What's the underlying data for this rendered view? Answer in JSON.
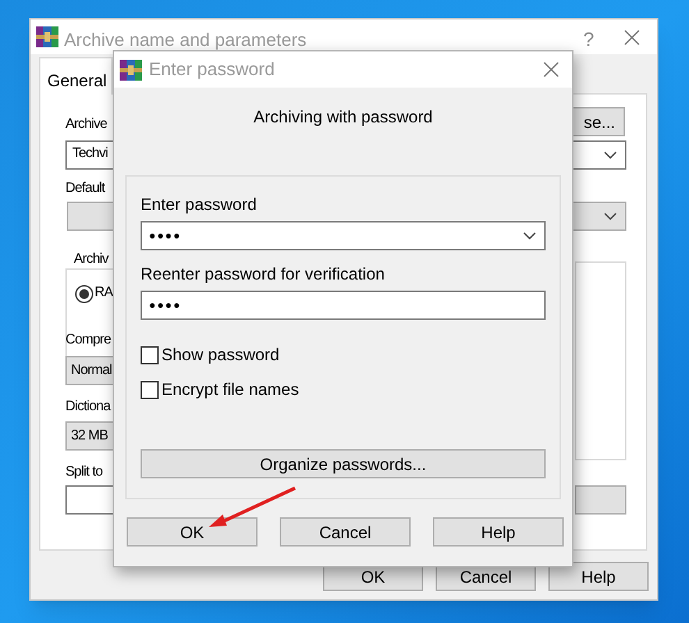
{
  "background_window": {
    "title": "Archive name and parameters",
    "help": "?",
    "tabs": [
      {
        "label": "General",
        "selected": true
      }
    ],
    "browse_button": "se...",
    "archive_name_label": "Archive",
    "archive_name": "Techvi",
    "default_label": "Default",
    "format_group": {
      "label": "Archiv",
      "options": [
        {
          "label": "RA",
          "selected": true
        }
      ]
    },
    "compression_label": "Compre",
    "compression": "Normal",
    "dictionary_label": "Dictiona",
    "dictionary": "32 MB",
    "split_label": "Split to",
    "buttons": [
      "OK",
      "Cancel",
      "Help"
    ]
  },
  "dialog": {
    "title": "Enter password",
    "heading": "Archiving with password",
    "password_label": "Enter password",
    "password": "●●●●",
    "reenter_label": "Reenter password for verification",
    "reenter": "●●●●",
    "checkboxes": [
      {
        "label": "Show password",
        "checked": false
      },
      {
        "label": "Encrypt file names",
        "checked": false
      }
    ],
    "organize_button": "Organize passwords...",
    "buttons": [
      "OK",
      "Cancel",
      "Help"
    ]
  }
}
